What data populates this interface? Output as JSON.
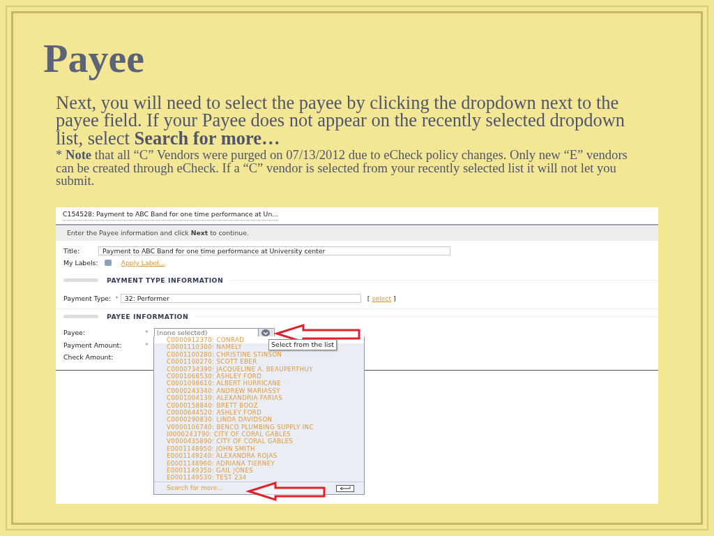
{
  "slide": {
    "title": "Payee",
    "intro": "Next, you will need to select the payee by clicking the dropdown next to the payee field. If your Payee does not appear on the recently selected dropdown list, select **Search for more…**",
    "note": "* **Note** that all “C” Vendors were purged on 07/13/2012 due to eCheck policy changes. Only new “E” vendors can be created through eCheck. If a “C” vendor is selected from your recently selected list it will not let you submit."
  },
  "app": {
    "breadcrumb": "C154528: Payment to ABC Band for one time performance at Un...",
    "instruction": "Enter the Payee information and click **Next** to continue.",
    "title_field": {
      "label": "Title:",
      "value": "Payment to ABC Band for one time performance at University center"
    },
    "labels_row": {
      "label": "My Labels:",
      "link": "Apply Label..."
    },
    "sections": [
      {
        "heading": "PAYMENT TYPE INFORMATION"
      },
      {
        "heading": "PAYEE INFORMATION"
      }
    ],
    "payment_type": {
      "label": "Payment Type:",
      "marker": "*",
      "value": "32: Performer",
      "bracket_open": "[",
      "link": "select",
      "bracket_close": "]"
    },
    "payee": {
      "label": "Payee:",
      "marker": "*",
      "placeholder": "(none selected)"
    },
    "payment_amount": {
      "label": "Payment Amount:",
      "marker": "*"
    },
    "check_amount": {
      "label": "Check Amount:"
    },
    "dropdown": {
      "items": [
        {
          "text": "C0000912370: CONRAD",
          "selected": true
        },
        {
          "text": "C0001110300: NAMELY",
          "selected": false
        },
        {
          "text": "C0001100280: CHRISTINE STINSON",
          "selected": false
        },
        {
          "text": "C0001100270: SCOTT EBER",
          "selected": false
        },
        {
          "text": "C0000734390: JACQUELINE A. BEAUPERTHUY",
          "selected": false
        },
        {
          "text": "C0001068530: ASHLEY FORD",
          "selected": false
        },
        {
          "text": "C0001098610: ALBERT HURRICANE",
          "selected": false
        },
        {
          "text": "C0000243340: ANDREW MARIASSY",
          "selected": false
        },
        {
          "text": "C0001004130: ALEXANDRIA FARIAS",
          "selected": false
        },
        {
          "text": "C0000158840: BRETT BOOZ",
          "selected": false
        },
        {
          "text": "C0000644520: ASHLEY FORD",
          "selected": false
        },
        {
          "text": "C0000290830: LINDA DAVIDSON",
          "selected": false
        },
        {
          "text": "V0000106740: BENCO PLUMBING SUPPLY INC",
          "selected": false
        },
        {
          "text": "I0000243790: CITY OF CORAL GABLES",
          "selected": false
        },
        {
          "text": "V0000435890: CITY OF CORAL GABLES",
          "selected": false
        },
        {
          "text": "E0001148950: JOHN SMITH",
          "selected": false
        },
        {
          "text": "E0001149240: ALEXANDRA ROJAS",
          "selected": false
        },
        {
          "text": "E0001148960: ADRIANA TIERNEY",
          "selected": false
        },
        {
          "text": "E0001149350: GAIL JONES",
          "selected": false
        },
        {
          "text": "E0001149530: TEST 234",
          "selected": false
        }
      ],
      "footer_link": "Search for more..."
    },
    "tooltip": "Select from the list"
  }
}
